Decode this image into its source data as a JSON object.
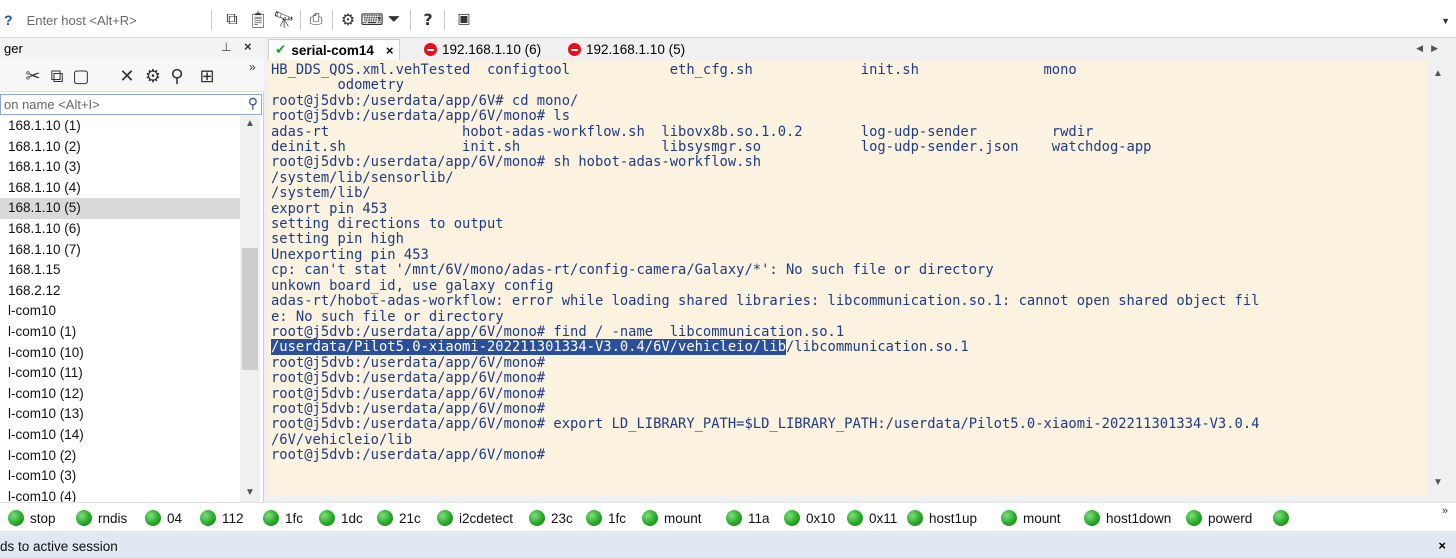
{
  "toolbar": {
    "host_placeholder": "Enter host <Alt+R>",
    "icons": [
      "copy-icon",
      "paste-icon",
      "find-icon",
      "print-icon",
      "settings-icon",
      "keymap-icon",
      "filter-icon",
      "help-icon",
      "screenshot-icon"
    ]
  },
  "session_manager": {
    "title": "ger",
    "pin_glyph": "📌",
    "close_glyph": "×",
    "search_placeholder": "on name <Alt+I>",
    "selected_index": 4,
    "items": [
      "168.1.10 (1)",
      "168.1.10 (2)",
      "168.1.10 (3)",
      "168.1.10 (4)",
      "168.1.10 (5)",
      "168.1.10 (6)",
      "168.1.10 (7)",
      "168.1.15",
      "168.2.12",
      "l-com10",
      "l-com10 (1)",
      "l-com10 (10)",
      "l-com10 (11)",
      "l-com10 (12)",
      "l-com10 (13)",
      "l-com10 (14)",
      "l-com10 (2)",
      "l-com10 (3)",
      "l-com10 (4)"
    ]
  },
  "tabs": [
    {
      "label": "serial-com14",
      "status": "connected",
      "close": "×"
    },
    {
      "label": "192.168.1.10 (6)",
      "status": "disconnected"
    },
    {
      "label": "192.168.1.10 (5)",
      "status": "disconnected"
    }
  ],
  "terminal": {
    "lines": [
      "HB_DDS_QOS.xml.vehTested  configtool            eth_cfg.sh             init.sh               mono",
      "        odometry",
      "root@j5dvb:/userdata/app/6V# cd mono/",
      "root@j5dvb:/userdata/app/6V/mono# ls",
      "adas-rt                hobot-adas-workflow.sh  libovx8b.so.1.0.2       log-udp-sender         rwdir",
      "deinit.sh              init.sh                 libsysmgr.so            log-udp-sender.json    watchdog-app",
      "root@j5dvb:/userdata/app/6V/mono# sh hobot-adas-workflow.sh",
      "/system/lib/sensorlib/",
      "/system/lib/",
      "export pin 453",
      "setting directions to output",
      "setting pin high",
      "Unexporting pin 453",
      "cp: can't stat '/mnt/6V/mono/adas-rt/config-camera/Galaxy/*': No such file or directory",
      "unkown board_id, use galaxy config",
      "adas-rt/hobot-adas-workflow: error while loading shared libraries: libcommunication.so.1: cannot open shared object fil",
      "e: No such file or directory",
      "root@j5dvb:/userdata/app/6V/mono# find / -name  libcommunication.so.1"
    ],
    "highlight_part": "/userdata/Pilot5.0-xiaomi-202211301334-V3.0.4/6V/vehicleio/lib",
    "highlight_rest": "/libcommunication.so.1",
    "lines_after": [
      "root@j5dvb:/userdata/app/6V/mono#",
      "root@j5dvb:/userdata/app/6V/mono#",
      "root@j5dvb:/userdata/app/6V/mono#",
      "root@j5dvb:/userdata/app/6V/mono#",
      "root@j5dvb:/userdata/app/6V/mono# export LD_LIBRARY_PATH=$LD_LIBRARY_PATH:/userdata/Pilot5.0-xiaomi-202211301334-V3.0.4",
      "/6V/vehicleio/lib",
      "root@j5dvb:/userdata/app/6V/mono#"
    ]
  },
  "buttons": [
    "stop",
    "rndis",
    "04",
    "112",
    "1fc",
    "1dc",
    "21c",
    "i2cdetect",
    "23c",
    "1fc",
    "mount",
    "11a",
    "0x10",
    "0x11",
    "host1up",
    "mount",
    "host1down",
    "powerd",
    ""
  ],
  "command_window": {
    "label": "ds to active session",
    "close": "×"
  },
  "colors": {
    "terminal_bg": "#fbf3df",
    "terminal_fg": "#1e3b87",
    "selection_bg": "#2c4f9a",
    "ok_green": "#1aa31a",
    "error_red": "#e3101b"
  }
}
